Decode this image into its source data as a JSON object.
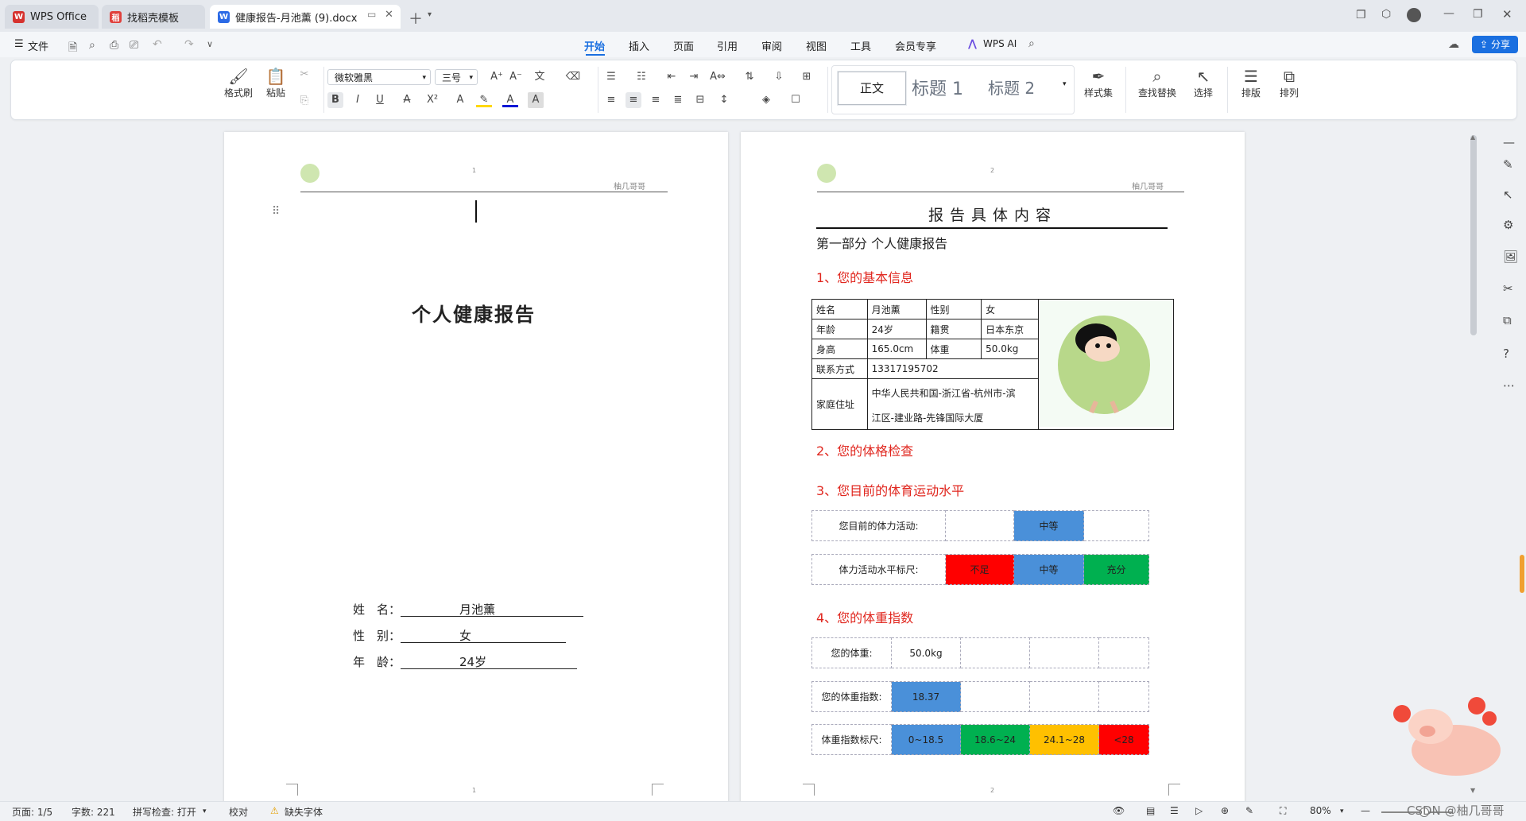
{
  "tabs": [
    {
      "label": "WPS Office",
      "logo": "W",
      "logo_color": "#d6322e"
    },
    {
      "label": "找稻壳模板",
      "logo": "稻",
      "logo_color": "#e0413d"
    },
    {
      "label": "健康报告-月池薰 (9).docx",
      "logo": "W",
      "logo_color": "#2b6ae6"
    }
  ],
  "menubar": {
    "file": "文件",
    "items": [
      "开始",
      "插入",
      "页面",
      "引用",
      "审阅",
      "视图",
      "工具",
      "会员专享"
    ],
    "ai": "WPS AI",
    "share": "分享"
  },
  "ribbon": {
    "format_painter": "格式刷",
    "paste": "粘贴",
    "font_name": "微软雅黑",
    "font_size": "三号",
    "style_normal": "正文",
    "style_h1": "标题 1",
    "style_h2": "标题 2",
    "style_set": "样式集",
    "find_replace": "查找替换",
    "select": "选择",
    "layout": "排版",
    "arrange": "排列"
  },
  "page1": {
    "header_num": "1",
    "footer_num": "1",
    "title": "个人健康报告",
    "fields": [
      {
        "label": "姓　名：",
        "value": "月池薰"
      },
      {
        "label": "性　别：",
        "value": "女"
      },
      {
        "label": "年　龄：",
        "value": "24岁"
      }
    ]
  },
  "page2": {
    "header_num": "2",
    "footer_num": "2",
    "header_right": "柚几哥哥",
    "main_title": "报告具体内容",
    "part_title": "第一部分 个人健康报告",
    "sec1": "1、您的基本信息",
    "info": {
      "name_label": "姓名",
      "name": "月池薰",
      "gender_label": "性别",
      "gender": "女",
      "age_label": "年龄",
      "age": "24岁",
      "native_label": "籍贯",
      "native": "日本东京",
      "height_label": "身高",
      "height": "165.0cm",
      "weight_label": "体重",
      "weight": "50.0kg",
      "phone_label": "联系方式",
      "phone": "13317195702",
      "address_label": "家庭住址",
      "address1": "中华人民共和国-浙江省-杭州市-滨",
      "address2": "江区-建业路-先锋国际大厦"
    },
    "sec2": "2、您的体格检查",
    "sec3": "3、您目前的体育运动水平",
    "activity_label": "您目前的体力活动:",
    "activity_value": "中等",
    "activity_scale_label": "体力活动水平标尺:",
    "activity_scale": [
      "不足",
      "中等",
      "充分"
    ],
    "sec4": "4、您的体重指数",
    "weight_label": "您的体重:",
    "weight_value": "50.0kg",
    "bmi_label": "您的体重指数:",
    "bmi_value": "18.37",
    "bmi_scale_label": "体重指数标尺:",
    "bmi_scale": [
      "0~18.5",
      "18.6~24",
      "24.1~28",
      "<28"
    ]
  },
  "colors": {
    "red": "#ff0000",
    "blue": "#4a90d9",
    "green": "#00b050",
    "orange": "#ffc000",
    "accent": "#1a6fe0"
  },
  "status": {
    "page": "页面: 1/5",
    "words": "字数: 221",
    "spell": "拼写检查: 打开",
    "proof": "校对",
    "missing_font": "缺失字体",
    "zoom": "80%",
    "watermark": "CSDN @柚几哥哥"
  }
}
